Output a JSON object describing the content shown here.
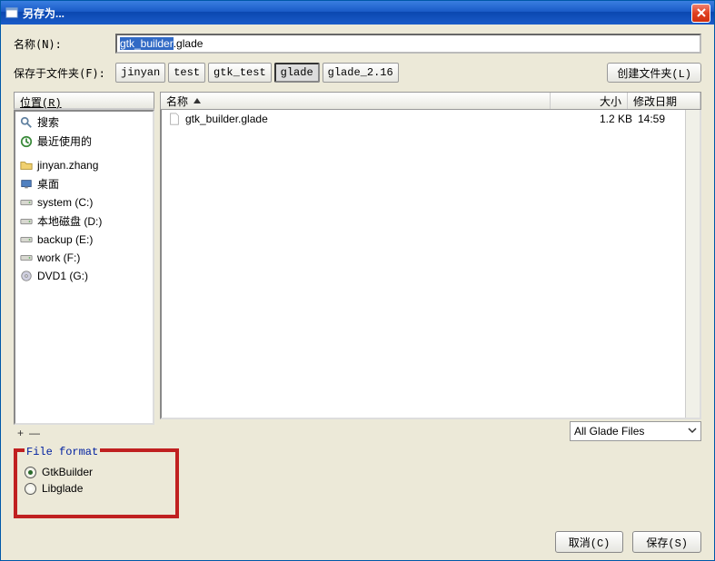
{
  "title": "另存为...",
  "labels": {
    "name": "名称(N):",
    "saveInFolder": "保存于文件夹(F):",
    "createFolder": "创建文件夹(L)",
    "locations": "位置(R)",
    "colName": "名称",
    "colSize": "大小",
    "colDate": "修改日期",
    "filter": "All Glade Files",
    "fileFormat": "File format",
    "cancel": "取消(C)",
    "save": "保存(S)",
    "plus": "+",
    "minus": "—"
  },
  "filename": {
    "selected": "gtk_builder",
    "rest": ".glade"
  },
  "pathSegments": [
    {
      "label": "jinyan",
      "active": false
    },
    {
      "label": "test",
      "active": false
    },
    {
      "label": "gtk_test",
      "active": false
    },
    {
      "label": "glade",
      "active": true
    },
    {
      "label": "glade_2.16",
      "active": false
    }
  ],
  "locations": [
    {
      "icon": "search",
      "label": "搜索"
    },
    {
      "icon": "recent",
      "label": "最近使用的"
    },
    {
      "gap": true
    },
    {
      "icon": "folder",
      "label": "jinyan.zhang"
    },
    {
      "icon": "desktop",
      "label": "桌面"
    },
    {
      "icon": "drive",
      "label": "system (C:)"
    },
    {
      "icon": "drive",
      "label": "本地磁盘 (D:)"
    },
    {
      "icon": "drive",
      "label": "backup (E:)"
    },
    {
      "icon": "drive",
      "label": "work (F:)"
    },
    {
      "icon": "dvd",
      "label": "DVD1 (G:)"
    }
  ],
  "files": [
    {
      "name": "gtk_builder.glade",
      "size": "1.2 KB",
      "date": "14:59"
    }
  ],
  "fileFormats": [
    {
      "label": "GtkBuilder",
      "selected": true
    },
    {
      "label": "Libglade",
      "selected": false
    }
  ],
  "watermark": ""
}
